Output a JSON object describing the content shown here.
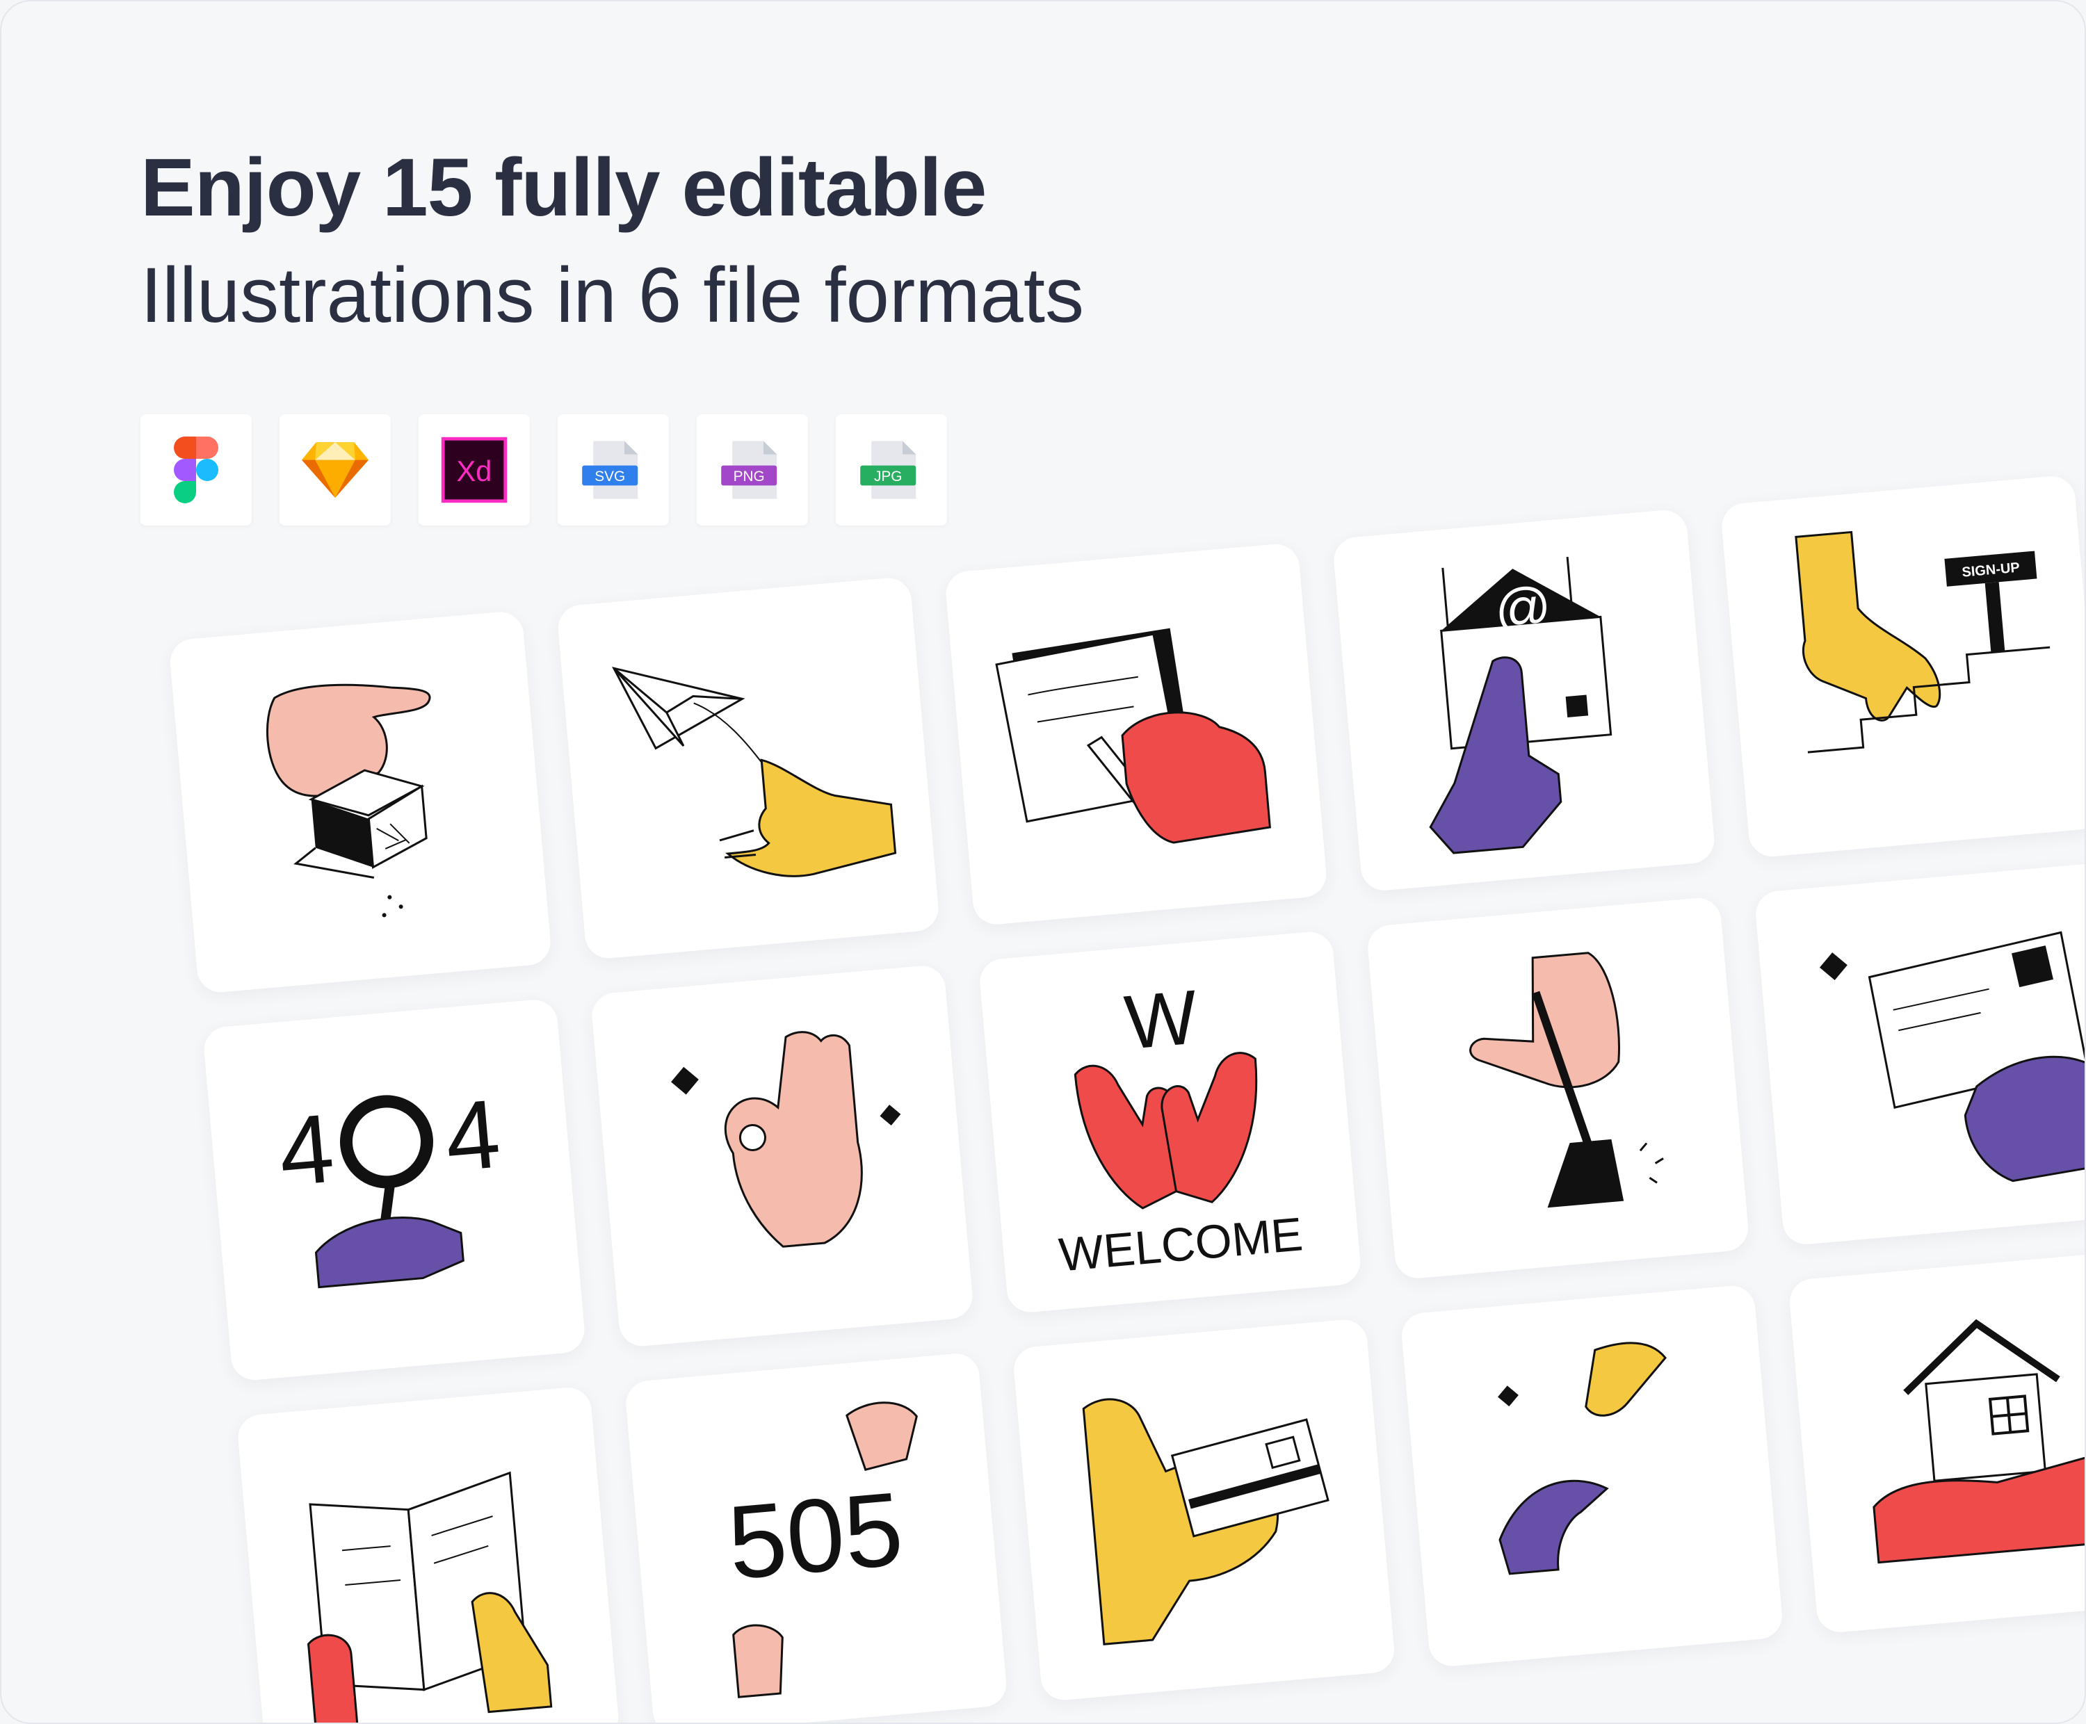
{
  "header": {
    "title": "Enjoy 15 fully editable",
    "subtitle": "Illustrations in 6 file formats"
  },
  "formats": [
    {
      "name": "figma-icon"
    },
    {
      "name": "sketch-icon"
    },
    {
      "name": "xd-icon",
      "label": "Xd"
    },
    {
      "name": "svg-file-icon",
      "label": "SVG"
    },
    {
      "name": "png-file-icon",
      "label": "PNG"
    },
    {
      "name": "jpg-file-icon",
      "label": "JPG"
    }
  ],
  "illustrations": {
    "signup_sign": "SIGN-UP",
    "error_404_left": "4",
    "error_404_right": "4",
    "welcome_letter": "W",
    "welcome_text": "WELCOME",
    "error_505": "505",
    "email_symbol": "@"
  },
  "colors": {
    "pink": "#f5bcae",
    "yellow": "#f5c842",
    "red": "#ef4b4b",
    "purple": "#6750a8",
    "ink": "#111111"
  }
}
